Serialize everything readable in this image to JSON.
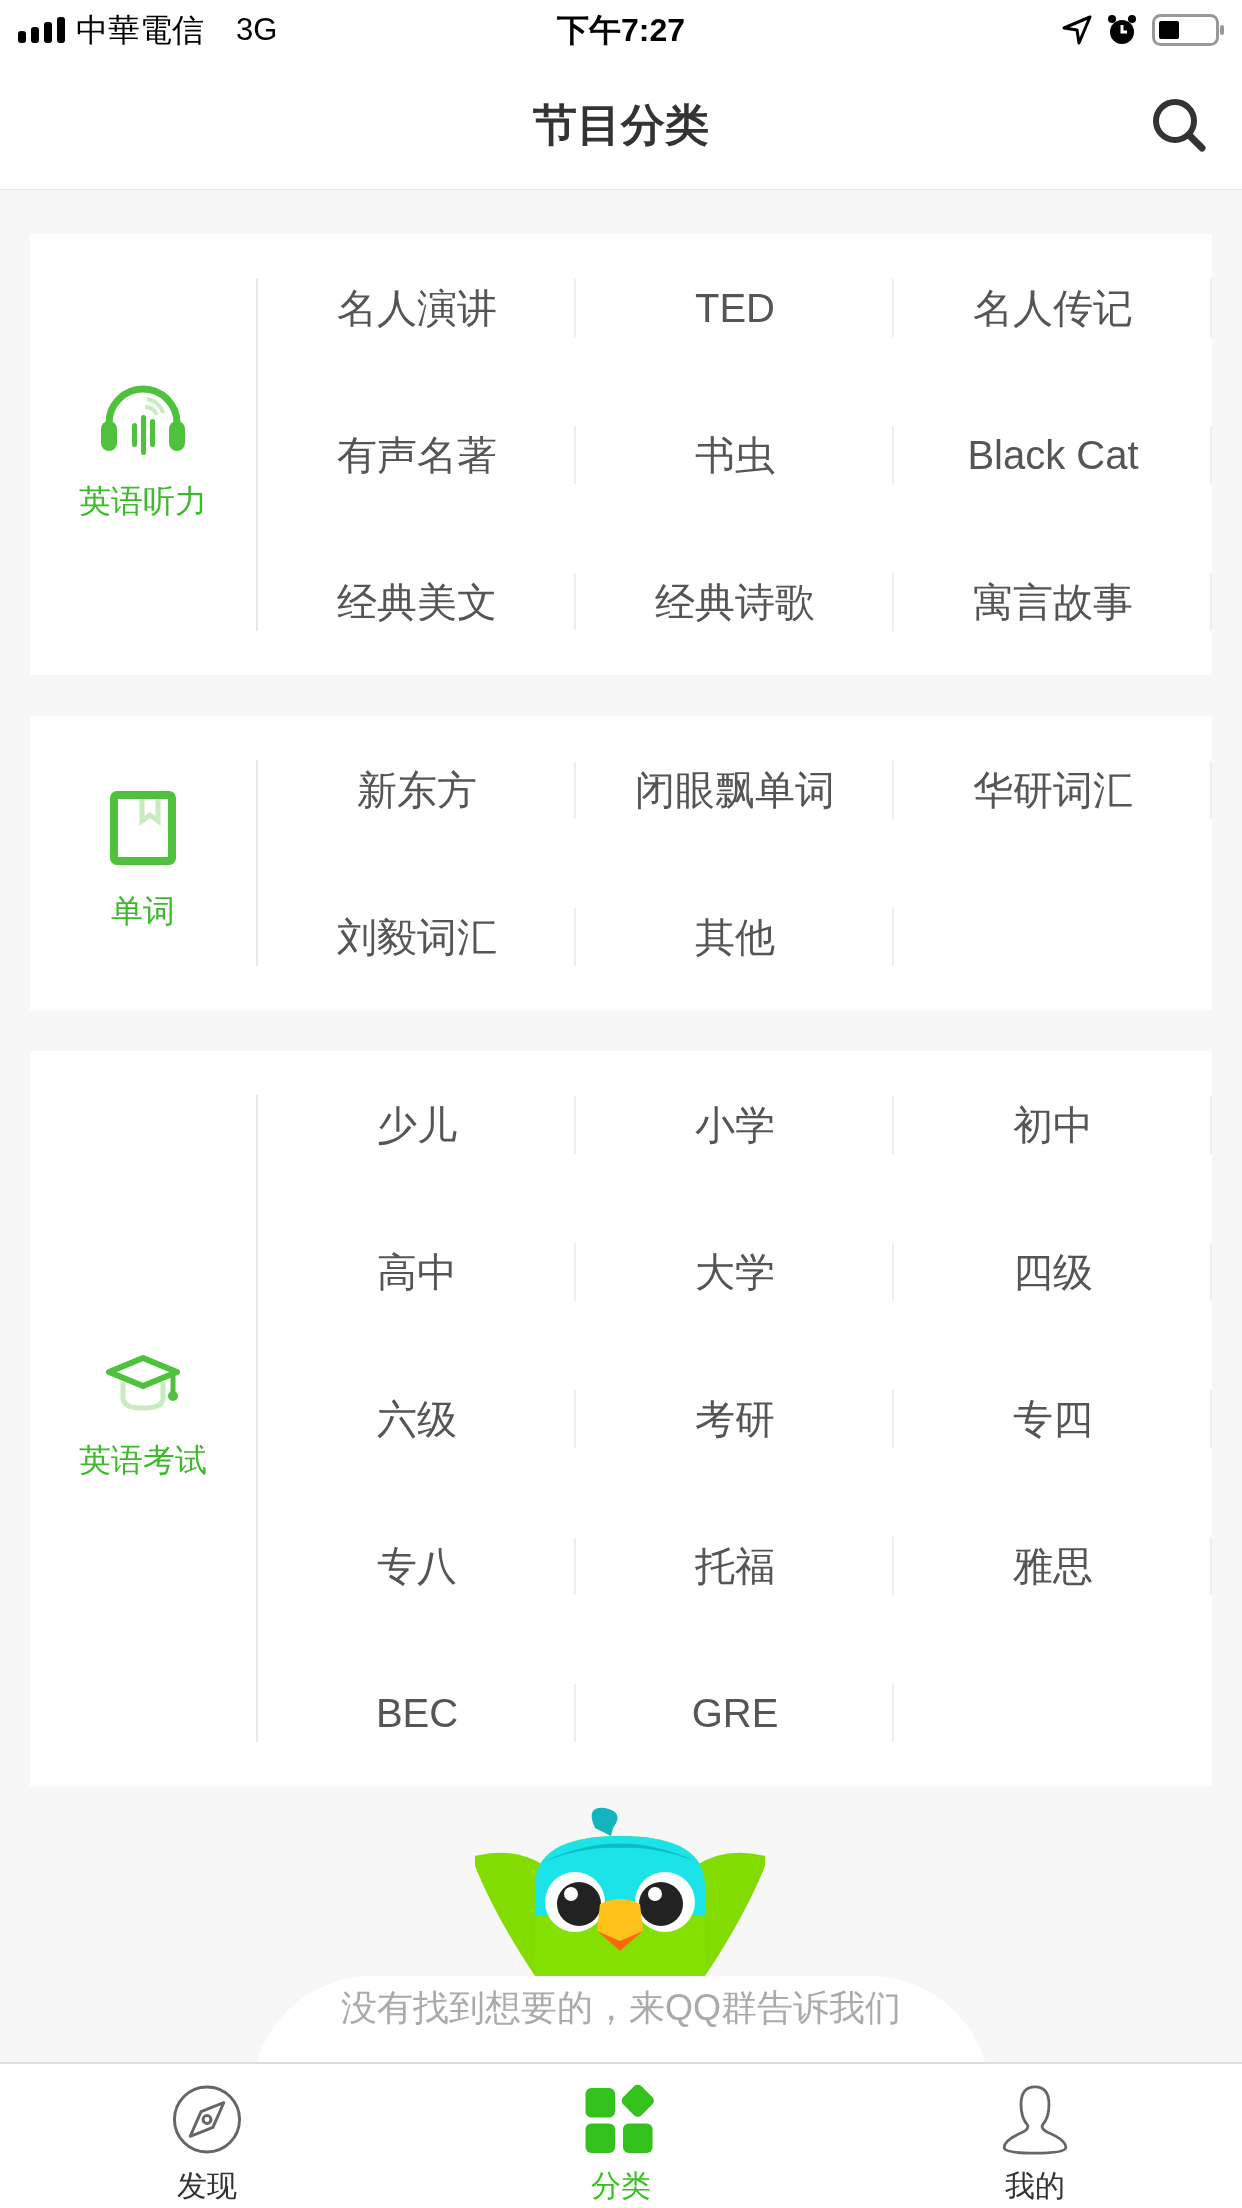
{
  "status_bar": {
    "carrier": "中華電信",
    "network": "3G",
    "time": "下午7:27"
  },
  "nav": {
    "title": "节目分类"
  },
  "sections": [
    {
      "title": "英语听力",
      "kind": "headphones",
      "items": [
        "名人演讲",
        "TED",
        "名人传记",
        "有声名著",
        "书虫",
        "Black Cat",
        "经典美文",
        "经典诗歌",
        "寓言故事"
      ]
    },
    {
      "title": "单词",
      "kind": "book",
      "items": [
        "新东方",
        "闭眼飘单词",
        "华研词汇",
        "刘毅词汇",
        "其他"
      ]
    },
    {
      "title": "英语考试",
      "kind": "cap",
      "items": [
        "少儿",
        "小学",
        "初中",
        "高中",
        "大学",
        "四级",
        "六级",
        "考研",
        "专四",
        "专八",
        "托福",
        "雅思",
        "BEC",
        "GRE"
      ]
    }
  ],
  "footer_text": "没有找到想要的，来QQ群告诉我们",
  "tabs": [
    {
      "label": "发现",
      "kind": "compass",
      "selected": false
    },
    {
      "label": "分类",
      "kind": "grid",
      "selected": true
    },
    {
      "label": "我的",
      "kind": "person",
      "selected": false
    }
  ]
}
